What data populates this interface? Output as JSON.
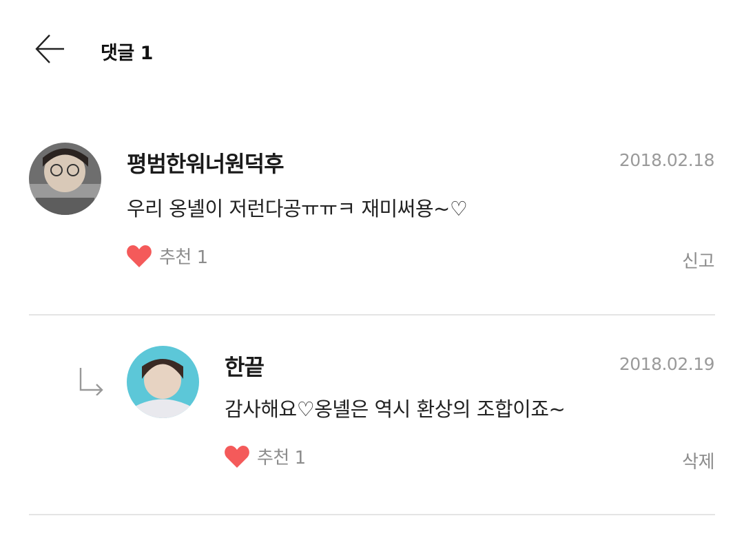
{
  "header": {
    "title": "댓글 1"
  },
  "comments": [
    {
      "nickname": "평범한워너원덕후",
      "date": "2018.02.18",
      "text": "우리 옹녤이 저런다공ㅠㅠㅋ 재미써용~♡",
      "like_label": "추천 1",
      "action_label": "신고"
    },
    {
      "nickname": "한끝",
      "date": "2018.02.19",
      "text": "감사해요♡옹녤은 역시 환상의 조합이죠~",
      "like_label": "추천 1",
      "action_label": "삭제"
    }
  ],
  "colors": {
    "heart": "#f45a5a",
    "muted": "#8c8c8c",
    "divider": "#e4e4e4"
  }
}
